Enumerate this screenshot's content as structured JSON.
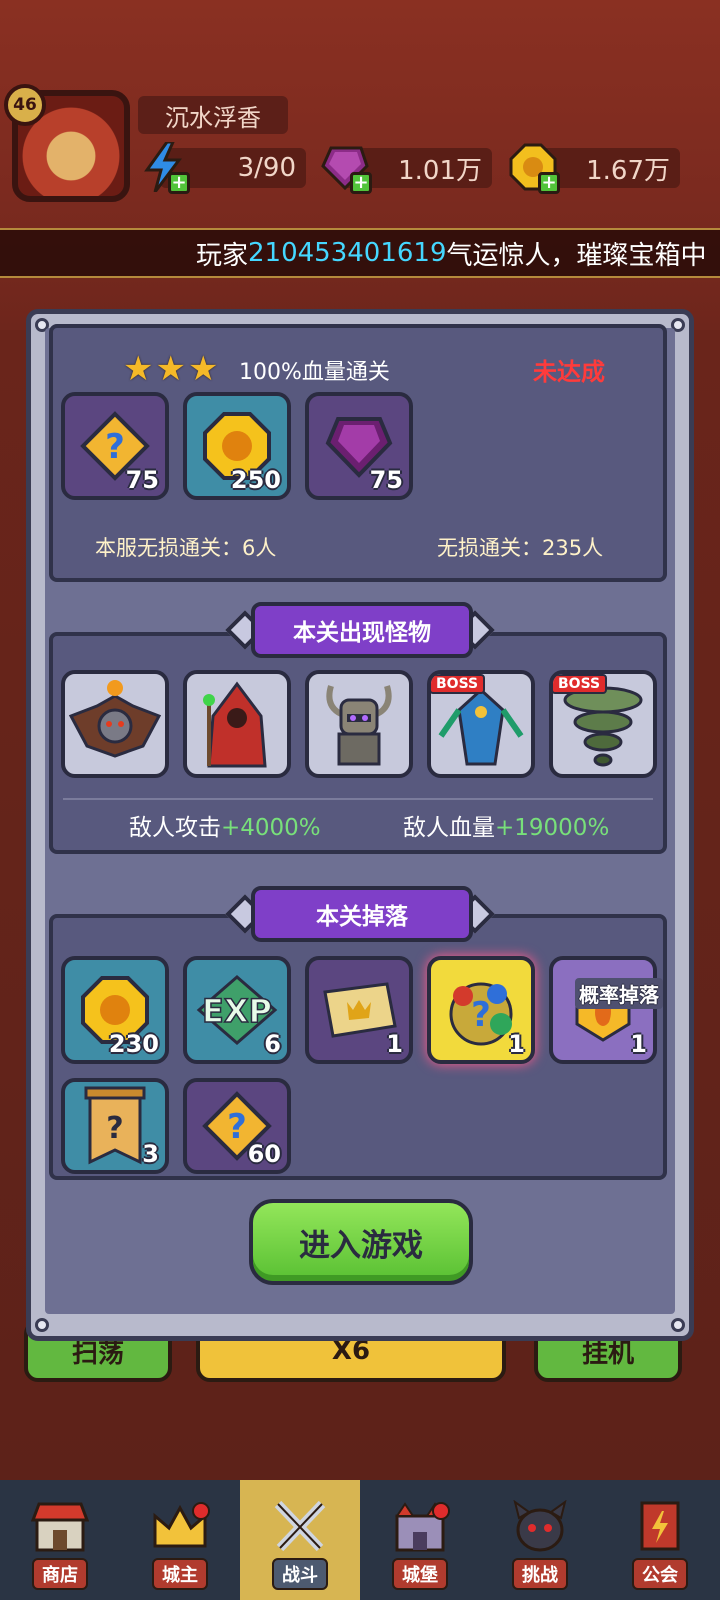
{
  "header": {
    "level": "46",
    "player_name": "沉水浮香",
    "energy": "3/90",
    "gems": "1.01万",
    "gold": "1.67万"
  },
  "ticker": {
    "prefix": "玩家",
    "player_id": "210453401619",
    "suffix": "气运惊人，璀璨宝箱中"
  },
  "modal": {
    "challenge": {
      "stars": 3,
      "condition": "100%血量通关",
      "status": "未达成",
      "rewards": [
        {
          "icon": "puzzle-piece-icon",
          "count": "75"
        },
        {
          "icon": "gold-coin-icon",
          "count": "250"
        },
        {
          "icon": "purple-gem-icon",
          "count": "75"
        }
      ],
      "server_clear": "本服无损通关：6人",
      "total_clear": "无损通关：235人"
    },
    "monsters": {
      "title": "本关出现怪物",
      "list": [
        {
          "icon": "bat-demon-icon",
          "boss": false
        },
        {
          "icon": "red-mage-icon",
          "boss": false
        },
        {
          "icon": "horned-knight-icon",
          "boss": false
        },
        {
          "icon": "blue-dragon-icon",
          "boss": true,
          "boss_label": "BOSS"
        },
        {
          "icon": "green-tornado-icon",
          "boss": true,
          "boss_label": "BOSS"
        }
      ],
      "attack_label": "敌人攻击",
      "attack_value": "+4000%",
      "hp_label": "敌人血量",
      "hp_value": "+19000%"
    },
    "drops": {
      "title": "本关掉落",
      "prob_label": "概率掉落",
      "items": [
        {
          "icon": "gold-coin-icon",
          "count": "230"
        },
        {
          "icon": "exp-icon",
          "count": "6",
          "text": "EXP"
        },
        {
          "icon": "ticket-icon",
          "count": "1"
        },
        {
          "icon": "mystery-gem-bag-icon",
          "count": "1"
        },
        {
          "icon": "fire-crest-icon",
          "count": "1"
        },
        {
          "icon": "scroll-banner-icon",
          "count": "3"
        },
        {
          "icon": "puzzle-piece-icon",
          "count": "60"
        }
      ]
    },
    "enter_button": "进入游戏"
  },
  "background_buttons": {
    "left": "扫荡",
    "center": "X6",
    "right": "挂机"
  },
  "nav": [
    {
      "label": "商店",
      "icon": "shop-icon",
      "dot": false
    },
    {
      "label": "城主",
      "icon": "crown-icon",
      "dot": true
    },
    {
      "label": "战斗",
      "icon": "crossed-swords-icon",
      "dot": false,
      "active": true
    },
    {
      "label": "城堡",
      "icon": "castle-icon",
      "dot": true
    },
    {
      "label": "挑战",
      "icon": "demon-mask-icon",
      "dot": false
    },
    {
      "label": "公会",
      "icon": "guild-banner-icon",
      "dot": false
    }
  ]
}
